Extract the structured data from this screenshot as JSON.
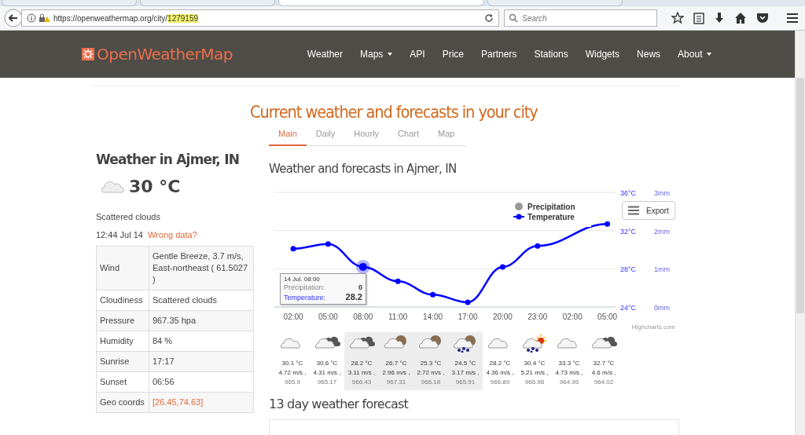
{
  "browser": {
    "tabs": [
      {
        "selected": false
      },
      {
        "selected": false
      },
      {
        "selected": true
      },
      {
        "selected": false
      }
    ],
    "url_prefix": "https://openweathermap.org/city/",
    "url_highlight": "1279159",
    "search": {
      "placeholder": "Search"
    }
  },
  "site": {
    "logo": "OpenWeatherMap",
    "nav": [
      {
        "label": "Weather",
        "dropdown": false
      },
      {
        "label": "Maps",
        "dropdown": true
      },
      {
        "label": "API",
        "dropdown": false
      },
      {
        "label": "Price",
        "dropdown": false
      },
      {
        "label": "Partners",
        "dropdown": false
      },
      {
        "label": "Stations",
        "dropdown": false
      },
      {
        "label": "Widgets",
        "dropdown": false
      },
      {
        "label": "News",
        "dropdown": false
      },
      {
        "label": "About",
        "dropdown": true
      }
    ]
  },
  "page_title": "Current weather and forecasts in your city",
  "tabs": [
    {
      "label": "Main",
      "selected": true
    },
    {
      "label": "Daily",
      "selected": false
    },
    {
      "label": "Hourly",
      "selected": false
    },
    {
      "label": "Chart",
      "selected": false
    },
    {
      "label": "Map",
      "selected": false
    }
  ],
  "current": {
    "title": "Weather in Ajmer, IN",
    "temperature": "30 °C",
    "description": "Scattered clouds",
    "time": "12:44 Jul 14",
    "wrong_data_link": "Wrong data?",
    "details": [
      {
        "label": "Wind",
        "value": "Gentle Breeze, 3.7 m/s, East-northeast ( 61.5027 )",
        "link": false
      },
      {
        "label": "Cloudiness",
        "value": "Scattered clouds",
        "link": false
      },
      {
        "label": "Pressure",
        "value": "967.35 hpa",
        "link": false
      },
      {
        "label": "Humidity",
        "value": "84 %",
        "link": false
      },
      {
        "label": "Sunrise",
        "value": "17:17",
        "link": false
      },
      {
        "label": "Sunset",
        "value": "06:56",
        "link": false
      },
      {
        "label": "Geo coords",
        "value": "[26.45,74.63]",
        "link": true
      }
    ]
  },
  "forecast_section": {
    "title": "Weather and forecasts in Ajmer, IN",
    "chart_data": {
      "type": "line",
      "categories": [
        "02:00",
        "05:00",
        "08:00",
        "11:00",
        "14:00",
        "17:00",
        "20:00",
        "23:00",
        "02:00",
        "05:00"
      ],
      "series": [
        {
          "name": "Temperature",
          "color": "#0000ff",
          "marker": true,
          "values": [
            30.1,
            30.6,
            28.2,
            26.7,
            25.3,
            24.5,
            28.2,
            30.4,
            null,
            32.7
          ]
        }
      ],
      "legend": [
        {
          "name": "Precipitation",
          "color": "#999999",
          "kind": "dot"
        }
      ],
      "ylim": [
        24,
        36
      ],
      "yticks": [
        {
          "value": 24,
          "label": "24°C"
        },
        {
          "value": 28,
          "label": "28°C"
        },
        {
          "value": 32,
          "label": "32°C"
        },
        {
          "value": 36,
          "label": "36°C"
        }
      ],
      "y2ticks": [
        "0mm",
        "1mm",
        "2mm",
        "3mm"
      ]
    },
    "tooltip": {
      "date": "14 Jul. 08:00",
      "rows": [
        {
          "label": "Precipitation:",
          "value": "0",
          "kind": "precipitation"
        },
        {
          "label": "Temperature:",
          "value": "28.2",
          "kind": "temperature"
        }
      ]
    },
    "export_button": "Export",
    "credit": "Highcharts.com",
    "hours": [
      {
        "kind": "cloud",
        "shaded": false,
        "temp": "30.1 °C",
        "wind": "4.72 m/s ,",
        "pressure": "965.9"
      },
      {
        "kind": "dark-cloud",
        "shaded": false,
        "temp": "30.6 °C",
        "wind": "4.31 m/s ,",
        "pressure": "965.17"
      },
      {
        "kind": "dark-cloud",
        "shaded": true,
        "temp": "28.2 °C",
        "wind": "3.11 m/s ,",
        "pressure": "966.43"
      },
      {
        "kind": "moon-cloud",
        "shaded": true,
        "temp": "26.7 °C",
        "wind": "2.96 m/s ,",
        "pressure": "967.31"
      },
      {
        "kind": "moon-cloud",
        "shaded": true,
        "temp": "25.3 °C",
        "wind": "2.72 m/s ,",
        "pressure": "966.18"
      },
      {
        "kind": "moon-rain",
        "shaded": true,
        "temp": "24.5 °C",
        "wind": "3.17 m/s ,",
        "pressure": "965.91"
      },
      {
        "kind": "cloud",
        "shaded": false,
        "temp": "28.2 °C",
        "wind": "4.36 m/s ,",
        "pressure": "966.89"
      },
      {
        "kind": "sun-rain",
        "shaded": false,
        "temp": "30.4 °C",
        "wind": "5.21 m/s ,",
        "pressure": "966.98"
      },
      {
        "kind": "cloud",
        "shaded": false,
        "temp": "33.3 °C",
        "wind": "4.73 m/s ,",
        "pressure": "964.95"
      },
      {
        "kind": "dark-cloud",
        "shaded": false,
        "temp": "32.7 °C",
        "wind": "4.6 m/s ,",
        "pressure": "964.02"
      }
    ]
  },
  "daily_title": "13 day weather forecast"
}
